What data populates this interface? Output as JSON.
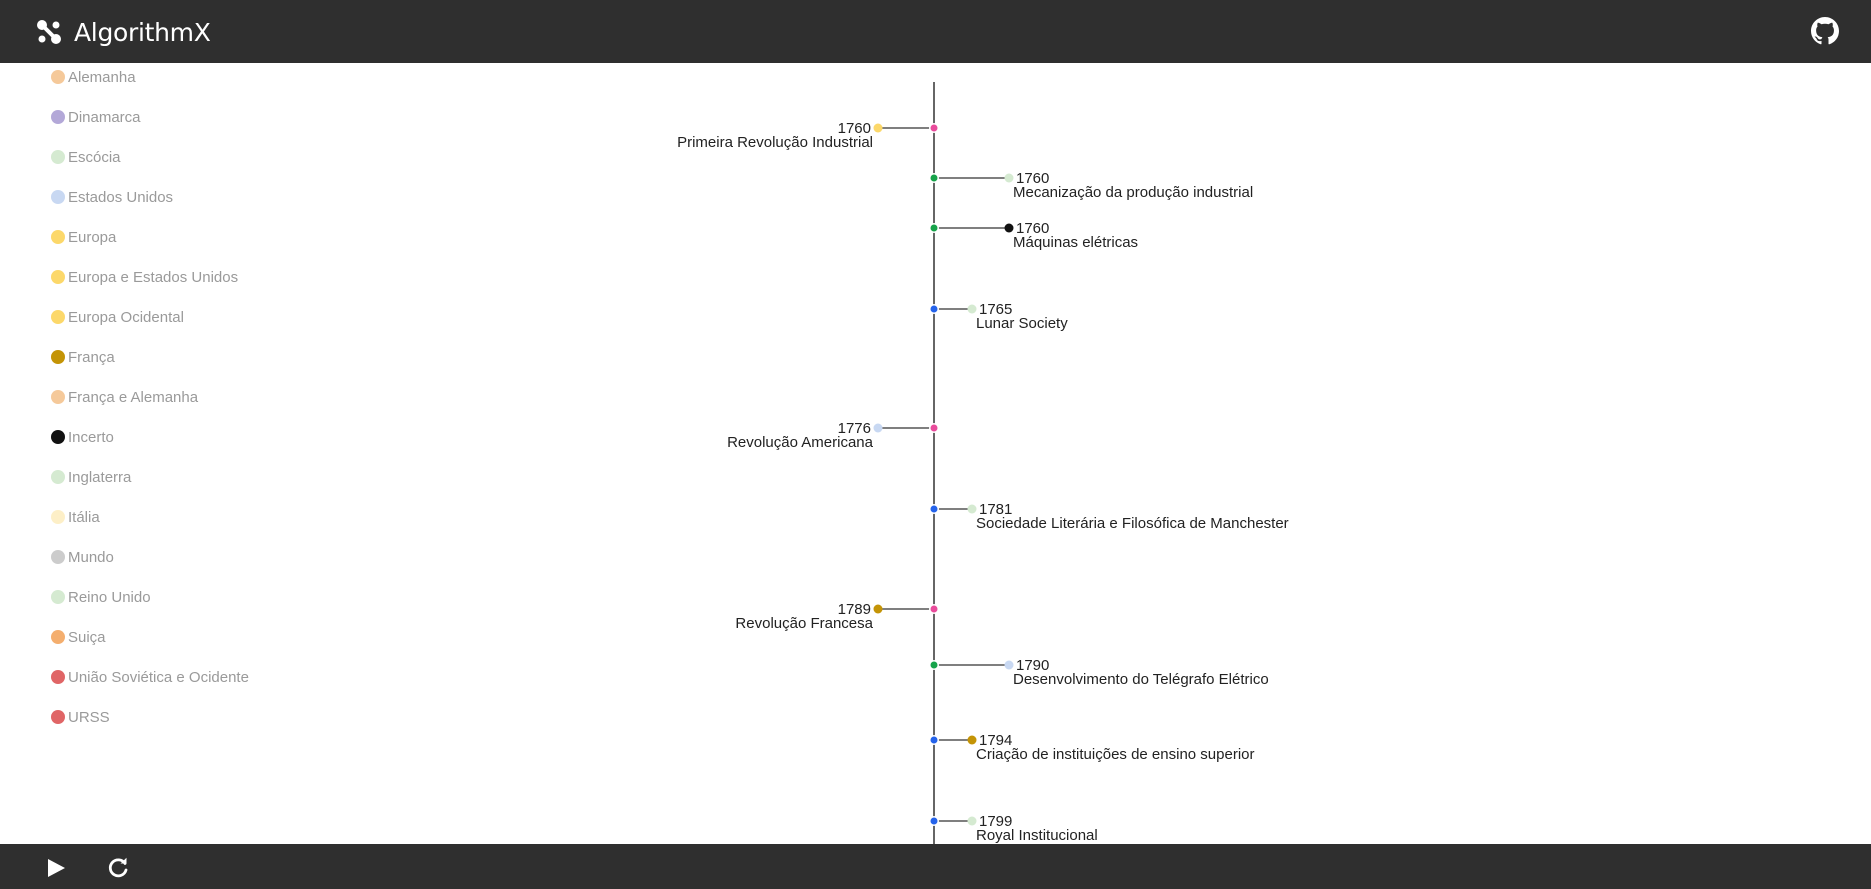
{
  "header": {
    "title": "AlgorithmX",
    "logo_icon": "algorithmx-logo-icon",
    "repo_icon": "github-icon"
  },
  "footer": {
    "play_icon": "play-icon",
    "reset_icon": "reset-icon"
  },
  "legend": [
    {
      "label": "Alemanha",
      "color": "#f5c99a"
    },
    {
      "label": "Dinamarca",
      "color": "#b3a8d8"
    },
    {
      "label": "Escócia",
      "color": "#d5ead1"
    },
    {
      "label": "Estados Unidos",
      "color": "#c8d8f2"
    },
    {
      "label": "Europa",
      "color": "#fcd86a"
    },
    {
      "label": "Europa e Estados Unidos",
      "color": "#fcd86a"
    },
    {
      "label": "Europa Ocidental",
      "color": "#fcd86a"
    },
    {
      "label": "França",
      "color": "#c49406"
    },
    {
      "label": "França e Alemanha",
      "color": "#f5c99a"
    },
    {
      "label": "Incerto",
      "color": "#111111"
    },
    {
      "label": "Inglaterra",
      "color": "#d5ead1"
    },
    {
      "label": "Itália",
      "color": "#fdefc7"
    },
    {
      "label": "Mundo",
      "color": "#cccccc"
    },
    {
      "label": "Reino Unido",
      "color": "#d5ead1"
    },
    {
      "label": "Suiça",
      "color": "#f4ae6e"
    },
    {
      "label": "União Soviética e Ocidente",
      "color": "#e06566"
    },
    {
      "label": "URSS",
      "color": "#e06566"
    }
  ],
  "timeline": {
    "events": [
      {
        "year": "1760",
        "title": "Primeira Revolução Industrial",
        "side": "left",
        "length": "short",
        "type_color": "#e94c9c",
        "region_color": "#fcd86a"
      },
      {
        "year": "1760",
        "title": "Mecanização da produção industrial",
        "side": "right",
        "length": "long",
        "type_color": "#16a34a",
        "region_color": "#d5ead1"
      },
      {
        "year": "1760",
        "title": "Máquinas elétricas",
        "side": "right",
        "length": "long",
        "type_color": "#16a34a",
        "region_color": "#111111"
      },
      {
        "year": "1765",
        "title": "Lunar Society",
        "side": "right",
        "length": "short",
        "type_color": "#2563eb",
        "region_color": "#d5ead1"
      },
      {
        "year": "1776",
        "title": "Revolução Americana",
        "side": "left",
        "length": "short",
        "type_color": "#e94c9c",
        "region_color": "#c8d8f2"
      },
      {
        "year": "1781",
        "title": "Sociedade Literária e Filosófica de Manchester",
        "side": "right",
        "length": "short",
        "type_color": "#2563eb",
        "region_color": "#d5ead1"
      },
      {
        "year": "1789",
        "title": "Revolução Francesa",
        "side": "left",
        "length": "short",
        "type_color": "#e94c9c",
        "region_color": "#c49406"
      },
      {
        "year": "1790",
        "title": "Desenvolvimento do Telégrafo Elétrico",
        "side": "right",
        "length": "long",
        "type_color": "#16a34a",
        "region_color": "#c8d8f2"
      },
      {
        "year": "1794",
        "title": "Criação de instituições de ensino superior",
        "side": "right",
        "length": "short",
        "type_color": "#2563eb",
        "region_color": "#c49406"
      },
      {
        "year": "1799",
        "title": "Royal Institucional",
        "side": "right",
        "length": "short",
        "type_color": "#2563eb",
        "region_color": "#d5ead1"
      }
    ]
  }
}
